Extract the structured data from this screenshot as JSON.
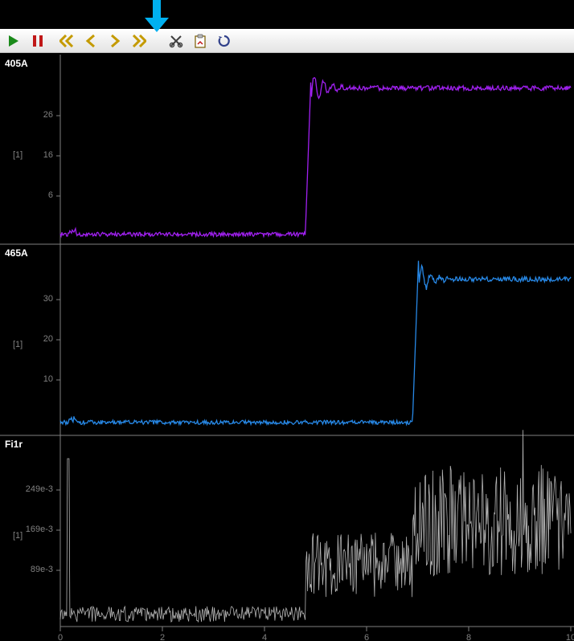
{
  "toolbar": {
    "play_label": "Play",
    "pause_label": "Pause",
    "rewind_label": "Rewind",
    "step_back_label": "Step Back",
    "step_fwd_label": "Step Forward",
    "ffwd_label": "Fast Forward",
    "split_label": "Split/Cut",
    "clipboard_label": "Copy",
    "refresh_label": "Refresh"
  },
  "channels": [
    {
      "name": "405A",
      "unit": "[1]",
      "color": "#a020f0"
    },
    {
      "name": "465A",
      "unit": "[1]",
      "color": "#2788e6"
    },
    {
      "name": "Fi1r",
      "unit": "[1]",
      "color": "#b4b4b4"
    }
  ],
  "chart_data": [
    {
      "type": "line",
      "title": "405A",
      "ylabel": "[1]",
      "xlim": [
        0,
        10
      ],
      "ylim": [
        0,
        36
      ],
      "yticks": [
        6,
        16,
        26
      ],
      "series": [
        {
          "name": "405A",
          "color": "#a020f0",
          "baseline": 1,
          "step_at": 4.8,
          "high": 30,
          "overshoot": 35
        }
      ]
    },
    {
      "type": "line",
      "title": "465A",
      "ylabel": "[1]",
      "xlim": [
        0,
        10
      ],
      "ylim": [
        0,
        44
      ],
      "yticks": [
        10,
        20,
        30
      ],
      "series": [
        {
          "name": "465A",
          "color": "#2788e6",
          "baseline": 2,
          "step_at": 6.9,
          "high": 37,
          "overshoot": 43
        }
      ]
    },
    {
      "type": "line",
      "title": "Fi1r",
      "ylabel": "[1]",
      "xlim": [
        0,
        10
      ],
      "ylim": [
        0.03,
        0.33
      ],
      "yticks": [
        "89e-3",
        "169e-3",
        "249e-3"
      ],
      "series": [
        {
          "name": "Fi1r",
          "color": "#b4b4b4",
          "levels": [
            {
              "from": 0,
              "to": 4.8,
              "low": 0.035,
              "high": 0.06
            },
            {
              "from": 4.8,
              "to": 6.9,
              "low": 0.075,
              "high": 0.18
            },
            {
              "from": 6.9,
              "to": 10,
              "low": 0.11,
              "high": 0.29
            }
          ]
        }
      ]
    }
  ],
  "x_axis": {
    "ticks": [
      "0",
      "2",
      "4",
      "6",
      "8",
      "10"
    ]
  }
}
